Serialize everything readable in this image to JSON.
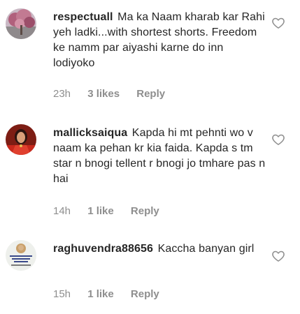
{
  "comments": [
    {
      "username": "respectuall",
      "text": "Ma ka Naam kharab kar Rahi yeh ladki...with shortest shorts. Freedom ke namm par aiyashi karne do inn lodiyoko",
      "time": "23h",
      "likes": "3 likes",
      "reply": "Reply",
      "avatar_icon": "blossom-tree-avatar"
    },
    {
      "username": "mallicksaiqua",
      "text": "Kapda hi mt pehnti wo v naam ka pehan kr kia faida. Kapda s tm star n bnogi tellent r bnogi jo tmhare pas n hai",
      "time": "14h",
      "likes": "1 like",
      "reply": "Reply",
      "avatar_icon": "woman-red-dress-avatar"
    },
    {
      "username": "raghuvendra88656",
      "text": "Kaccha banyan girl",
      "time": "15h",
      "likes": "1 like",
      "reply": "Reply",
      "avatar_icon": "poster-avatar"
    }
  ],
  "colors": {
    "text": "#262626",
    "muted": "#8e8e8e",
    "heart": "#8e8e8e"
  }
}
